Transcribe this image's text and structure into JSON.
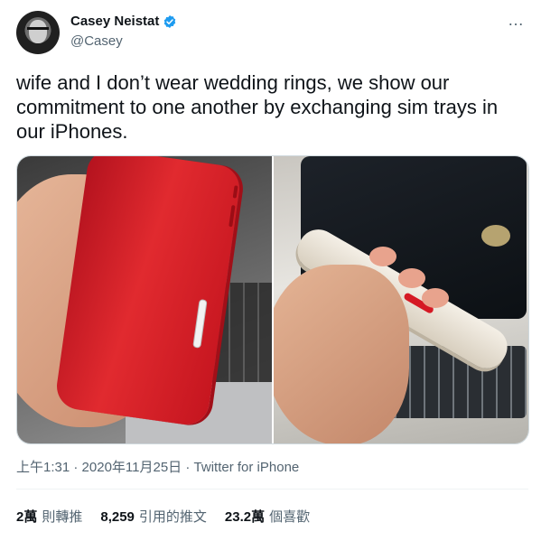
{
  "author": {
    "display_name": "Casey Neistat",
    "handle": "@Casey",
    "verified": true
  },
  "more_icon": "…",
  "tweet_text": "wife and I don’t wear wedding rings, we show our commitment to one another by exchanging sim trays in our iPhones.",
  "media": {
    "count": 2,
    "items": [
      "red-iphone-photo",
      "white-iphone-photo"
    ]
  },
  "meta": {
    "time": "上午1:31",
    "separator": " · ",
    "date": "2020年11月25日",
    "source": "Twitter for iPhone"
  },
  "stats": [
    {
      "value": "2萬",
      "label": "則轉推"
    },
    {
      "value": "8,259",
      "label": "引用的推文"
    },
    {
      "value": "23.2萬",
      "label": "個喜歡"
    }
  ],
  "colors": {
    "text_primary": "#0f1419",
    "text_secondary": "#536471",
    "verified_blue": "#1d9bf0",
    "border": "#cfd9de"
  }
}
